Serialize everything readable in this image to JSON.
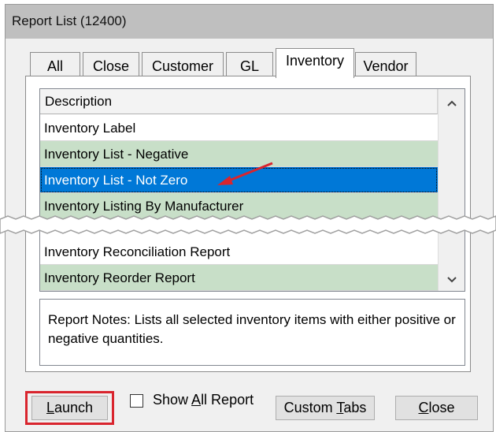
{
  "window": {
    "title": "Report List (12400)"
  },
  "tabs": [
    {
      "label": "All"
    },
    {
      "label": "Close"
    },
    {
      "label": "Customer"
    },
    {
      "label": "GL"
    },
    {
      "label": "Inventory"
    },
    {
      "label": "Vendor"
    }
  ],
  "list": {
    "header": "Description",
    "rows": [
      {
        "label": "Inventory Label"
      },
      {
        "label": "Inventory List - Negative"
      },
      {
        "label": "Inventory List - Not Zero"
      },
      {
        "label": "Inventory Listing By Manufacturer"
      },
      {
        "label": "Inventory Reconciliation Report"
      },
      {
        "label": "Inventory Reorder Report"
      }
    ]
  },
  "notes": {
    "text": "Report Notes:  Lists all selected inventory items with either positive or negative quantities."
  },
  "buttons": {
    "launch_pre": "",
    "launch_u": "L",
    "launch_post": "aunch",
    "show_all_pre": "Show ",
    "show_all_u": "A",
    "show_all_post": "ll Report",
    "custom_tabs_pre": "Custom ",
    "custom_tabs_u": "T",
    "custom_tabs_post": "abs",
    "close_pre": "",
    "close_u": "C",
    "close_post": "lose"
  },
  "colors": {
    "selected_row": "#0078d7",
    "alt_row": "#c8dfc8",
    "annotation_red": "#d9252e"
  },
  "icons": {
    "scroll_up": "▲",
    "scroll_down": "▼"
  }
}
